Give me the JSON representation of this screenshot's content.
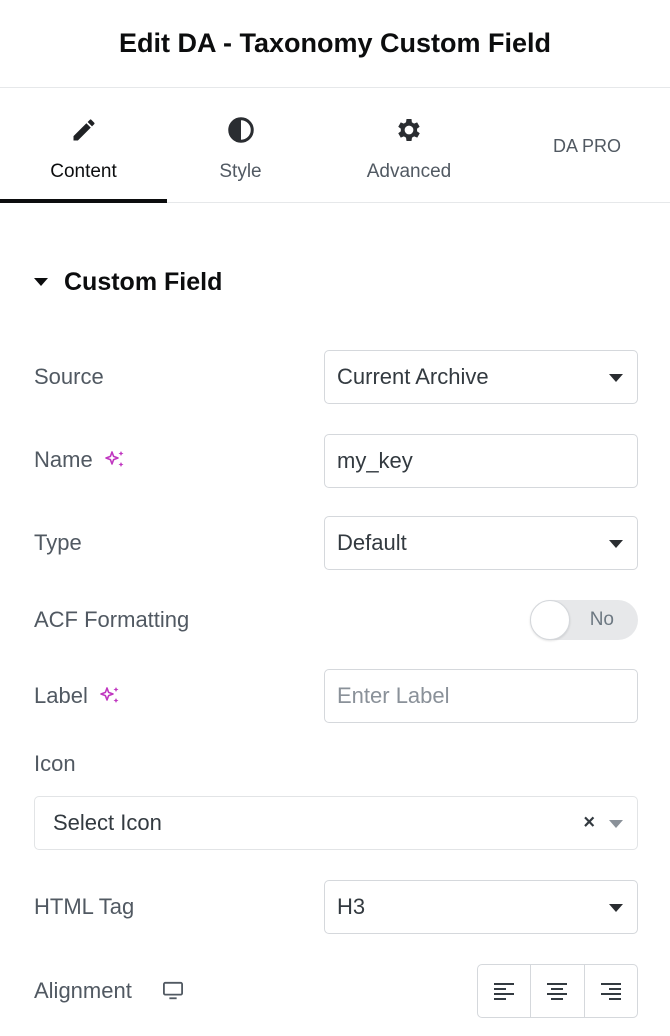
{
  "header": {
    "title": "Edit DA - Taxonomy Custom Field"
  },
  "tabs": [
    {
      "label": "Content",
      "icon": "pencil-icon",
      "active": true
    },
    {
      "label": "Style",
      "icon": "half-circle-icon",
      "active": false
    },
    {
      "label": "Advanced",
      "icon": "gear-icon",
      "active": false
    },
    {
      "label": "DA PRO",
      "icon": "",
      "active": false
    }
  ],
  "section": {
    "title": "Custom Field",
    "expanded": true
  },
  "fields": {
    "source": {
      "label": "Source",
      "value": "Current Archive"
    },
    "name": {
      "label": "Name",
      "value": "my_key"
    },
    "type": {
      "label": "Type",
      "value": "Default"
    },
    "acf_formatting": {
      "label": "ACF Formatting",
      "toggle_text": "No",
      "enabled": false
    },
    "label": {
      "label": "Label",
      "placeholder": "Enter Label"
    },
    "icon": {
      "label": "Icon",
      "value": "Select Icon",
      "clear": "×"
    },
    "html_tag": {
      "label": "HTML Tag",
      "value": "H3"
    },
    "alignment": {
      "label": "Alignment",
      "options": [
        "left",
        "center",
        "right"
      ]
    }
  },
  "colors": {
    "accent": "#c036c0",
    "text": "#515962",
    "active_tab": "#0c0d0e"
  }
}
